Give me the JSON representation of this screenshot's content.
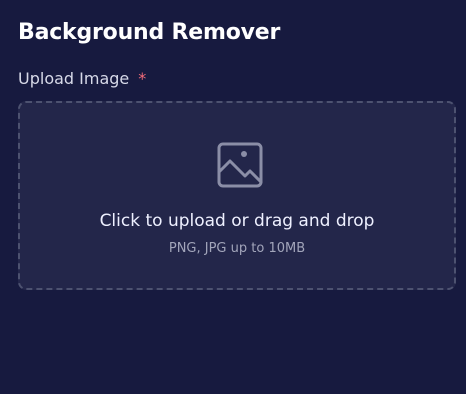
{
  "app": {
    "title": "Background Remover"
  },
  "upload_field": {
    "label": "Upload Image",
    "required_marker": "*",
    "dropzone": {
      "icon": "image-icon",
      "main_text": "Click to upload or drag and drop",
      "hint_text": "PNG, JPG up to 10MB"
    }
  },
  "colors": {
    "background": "#171a3f",
    "dropzone_background": "#23264a",
    "dropzone_border": "#4d5270",
    "required_marker": "#f26b7a"
  }
}
